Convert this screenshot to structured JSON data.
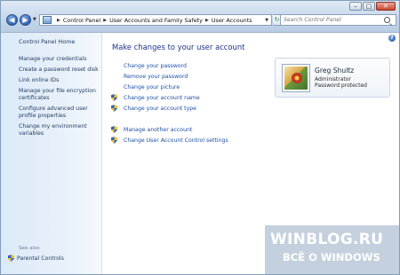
{
  "window": {
    "caption_buttons": [
      "–",
      "□",
      "✕"
    ]
  },
  "toolbar": {
    "back_glyph": "◀",
    "forward_glyph": "▶",
    "refresh_glyph": "↻",
    "breadcrumb": [
      "Control Panel",
      "User Accounts and Family Safety",
      "User Accounts"
    ],
    "search_placeholder": "Search Control Panel"
  },
  "sidebar": {
    "home": "Control Panel Home",
    "tasks": [
      "Manage your credentials",
      "Create a password reset disk",
      "Link online IDs",
      "Manage your file encryption certificates",
      "Configure advanced user profile properties",
      "Change my environment variables"
    ],
    "see_also_heading": "See also",
    "see_also_items": [
      "Parental Controls"
    ]
  },
  "main": {
    "help_glyph": "?",
    "title": "Make changes to your user account",
    "links_group1": [
      {
        "label": "Change your password",
        "shield": false
      },
      {
        "label": "Remove your password",
        "shield": false
      },
      {
        "label": "Change your picture",
        "shield": false
      },
      {
        "label": "Change your account name",
        "shield": true
      },
      {
        "label": "Change your account type",
        "shield": true
      }
    ],
    "links_group2": [
      {
        "label": "Manage another account",
        "shield": true
      },
      {
        "label": "Change User Account Control settings",
        "shield": true
      }
    ]
  },
  "user_card": {
    "name": "Greg Shultz",
    "role": "Administrator",
    "status": "Password protected"
  },
  "watermark": {
    "line1": "WINBLOG.RU",
    "line2": "ВСЁ О WINDOWS"
  },
  "colors": {
    "link": "#1e4fa4",
    "title": "#1e3287",
    "sidebar_link": "#1e395b",
    "sidebar_bg": "#dbe9f8"
  }
}
